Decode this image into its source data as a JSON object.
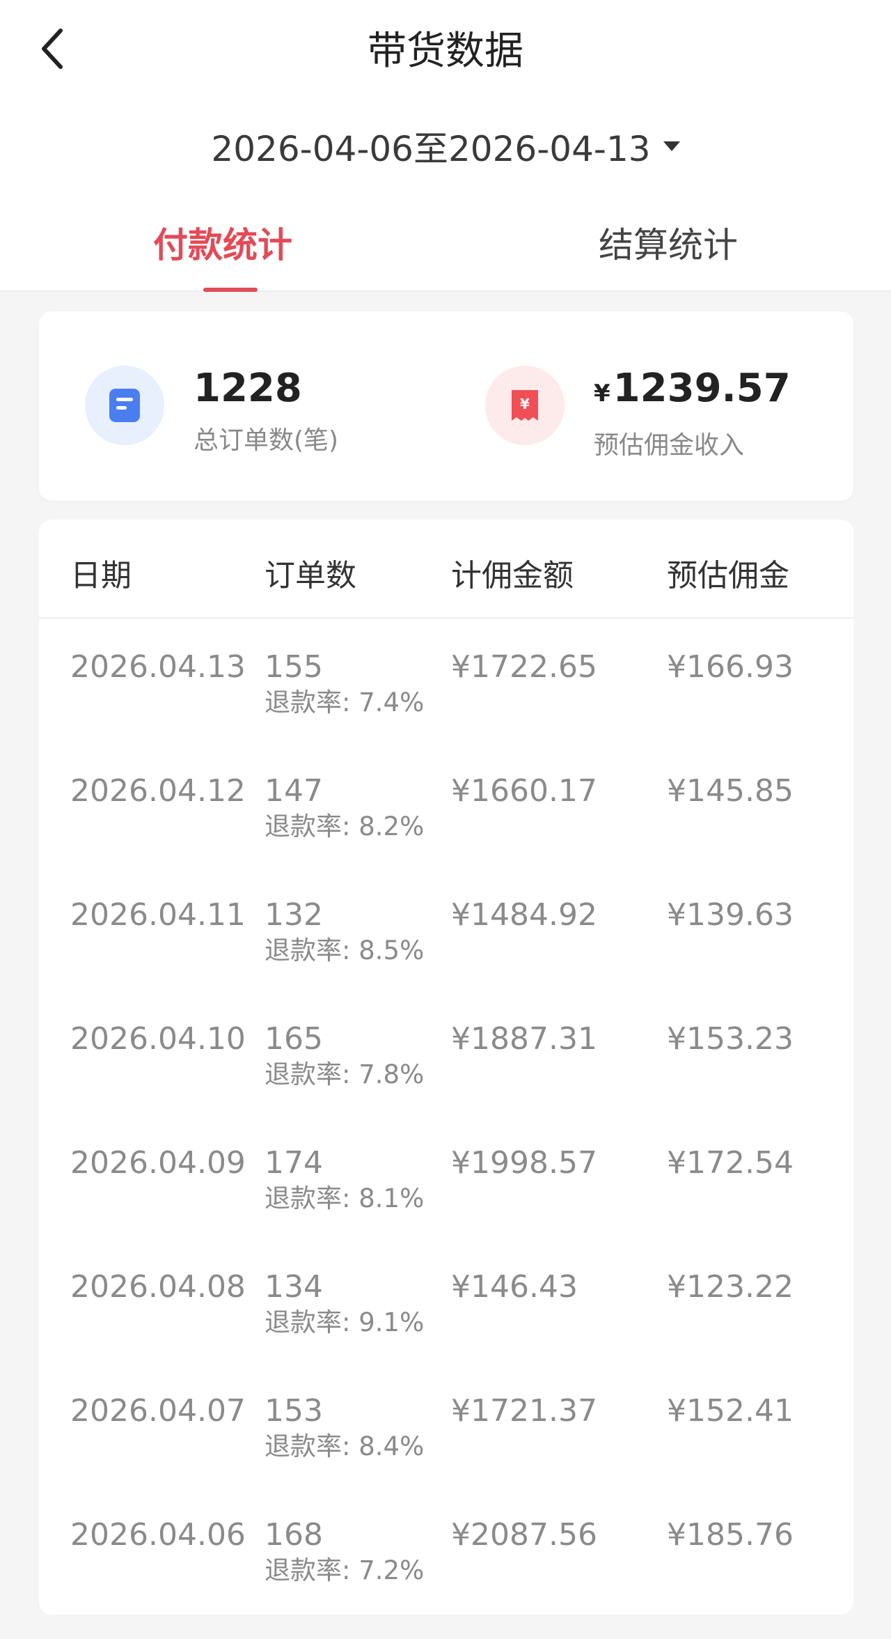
{
  "header": {
    "title": "带货数据"
  },
  "date_range": "2026-04-06至2026-04-13",
  "tabs": [
    {
      "label": "付款统计",
      "active": true
    },
    {
      "label": "结算统计",
      "active": false
    }
  ],
  "summary": {
    "orders": {
      "value": "1228",
      "label": "总订单数(笔)",
      "icon": "document-icon",
      "color": "#4a7ef0"
    },
    "commission": {
      "currency": "¥",
      "value": "1239.57",
      "label": "预估佣金收入",
      "icon": "receipt-yen-icon",
      "color": "#ef4f55"
    }
  },
  "table": {
    "headers": [
      "日期",
      "订单数",
      "计佣金额",
      "预估佣金"
    ],
    "rows": [
      {
        "date": "2026.04.13",
        "orders": "155",
        "refund": "退款率: 7.4%",
        "amount": "¥1722.65",
        "commission": "¥166.93"
      },
      {
        "date": "2026.04.12",
        "orders": "147",
        "refund": "退款率: 8.2%",
        "amount": "¥1660.17",
        "commission": "¥145.85"
      },
      {
        "date": "2026.04.11",
        "orders": "132",
        "refund": "退款率: 8.5%",
        "amount": "¥1484.92",
        "commission": "¥139.63"
      },
      {
        "date": "2026.04.10",
        "orders": "165",
        "refund": "退款率: 7.8%",
        "amount": "¥1887.31",
        "commission": "¥153.23"
      },
      {
        "date": "2026.04.09",
        "orders": "174",
        "refund": "退款率: 8.1%",
        "amount": "¥1998.57",
        "commission": "¥172.54"
      },
      {
        "date": "2026.04.08",
        "orders": "134",
        "refund": "退款率: 9.1%",
        "amount": "¥146.43",
        "commission": "¥123.22"
      },
      {
        "date": "2026.04.07",
        "orders": "153",
        "refund": "退款率: 8.4%",
        "amount": "¥1721.37",
        "commission": "¥152.41"
      },
      {
        "date": "2026.04.06",
        "orders": "168",
        "refund": "退款率: 7.2%",
        "amount": "¥2087.56",
        "commission": "¥185.76"
      }
    ]
  },
  "colors": {
    "accent": "#e24b57",
    "orders_icon_bg": "#e8effd",
    "commission_icon_bg": "#fdeaea"
  }
}
